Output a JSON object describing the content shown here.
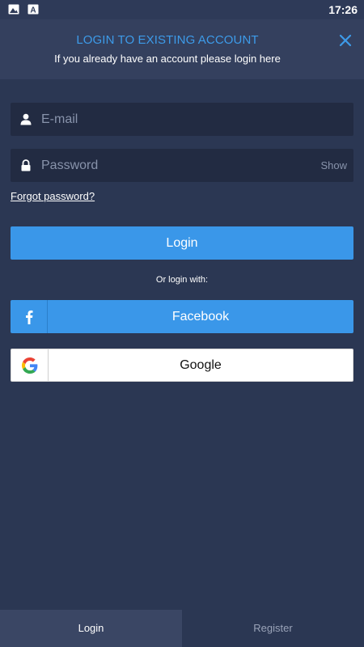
{
  "status_bar": {
    "time": "17:26",
    "icons": [
      "gallery-icon",
      "a-notification-icon"
    ]
  },
  "header": {
    "title": "LOGIN TO EXISTING ACCOUNT",
    "subtitle": "If you already have an account please login here",
    "close_icon": "close-icon",
    "accent_color": "#3d9be9"
  },
  "form": {
    "email": {
      "placeholder": "E-mail",
      "value": "",
      "icon": "person-icon"
    },
    "password": {
      "placeholder": "Password",
      "value": "",
      "icon": "lock-icon",
      "show_label": "Show"
    },
    "forgot_label": "Forgot password?",
    "login_label": "Login",
    "or_label": "Or login with:",
    "facebook_label": "Facebook",
    "google_label": "Google"
  },
  "tabs": [
    {
      "label": "Login",
      "active": true
    },
    {
      "label": "Register",
      "active": false
    }
  ],
  "colors": {
    "background": "#2b3753",
    "header": "#34405e",
    "primary": "#3a97e9",
    "input": "#222b42"
  }
}
